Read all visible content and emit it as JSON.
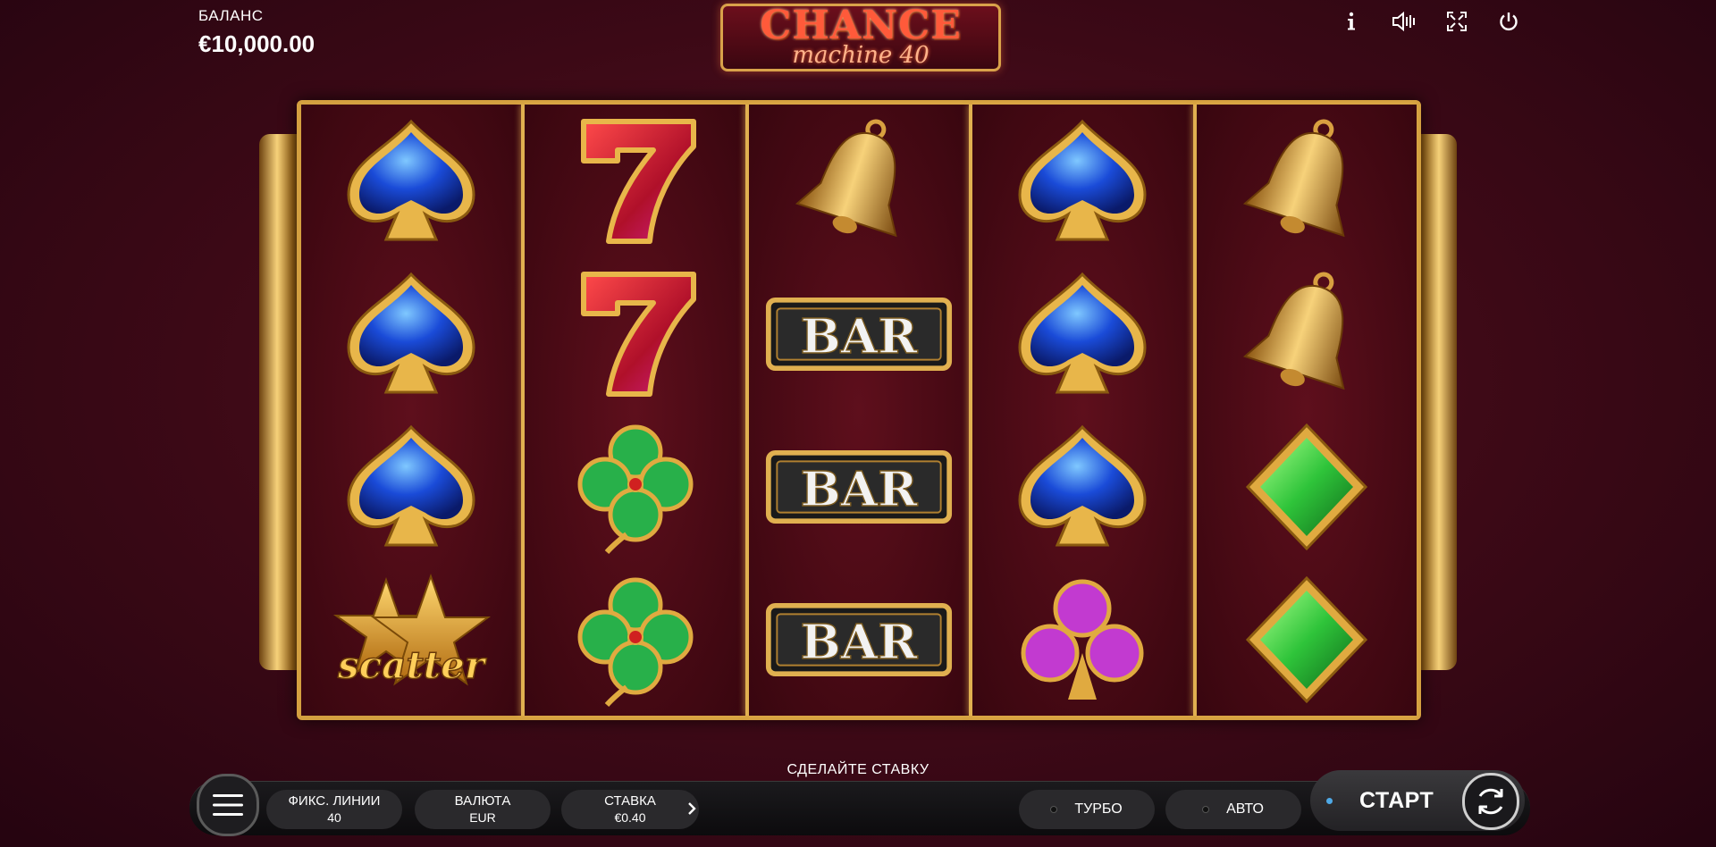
{
  "balance": {
    "label": "БАЛАНС",
    "value": "€10,000.00"
  },
  "logo": {
    "line1": "CHANCE",
    "line2": "machine 40"
  },
  "top_icons": [
    "info-icon",
    "sound-icon",
    "fullscreen-icon",
    "power-icon"
  ],
  "reels": [
    [
      "spade",
      "spade",
      "spade",
      "scatter"
    ],
    [
      "seven",
      "seven",
      "clover",
      "clover"
    ],
    [
      "bell",
      "bar",
      "bar",
      "bar"
    ],
    [
      "spade",
      "spade",
      "spade",
      "club"
    ],
    [
      "bell",
      "bell",
      "diamond",
      "diamond"
    ]
  ],
  "symbols": {
    "bar_text": "BAR",
    "scatter_text": "scatter"
  },
  "controls": {
    "prompt": "СДЕЛАЙТЕ СТАВКУ",
    "lines_label": "ФИКС. ЛИНИИ",
    "lines_value": "40",
    "currency_label": "ВАЛЮТА",
    "currency_value": "EUR",
    "bet_label": "СТАВКА",
    "bet_value": "€0.40",
    "turbo_label": "ТУРБО",
    "auto_label": "АВТО",
    "start_label": "СТАРТ"
  },
  "colors": {
    "gold": "#d4a040",
    "background": "#3c0916",
    "bar": "#141316"
  }
}
